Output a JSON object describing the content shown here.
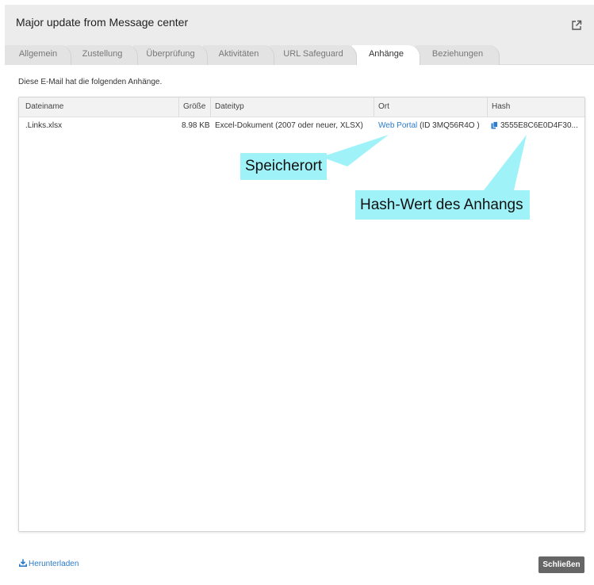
{
  "dialog": {
    "title": "Major update from Message center"
  },
  "tabs": [
    {
      "label": "Allgemein"
    },
    {
      "label": "Zustellung"
    },
    {
      "label": "Überprüfung"
    },
    {
      "label": "Aktivitäten"
    },
    {
      "label": "URL Safeguard"
    },
    {
      "label": "Anhänge"
    },
    {
      "label": "Beziehungen"
    }
  ],
  "intro": "Diese E-Mail hat die folgenden Anhänge.",
  "table": {
    "columns": [
      "Dateiname",
      "Größe",
      "Dateityp",
      "Ort",
      "Hash"
    ],
    "rows": [
      {
        "filename": ".Links.xlsx",
        "size": "8.98 KB",
        "filetype": "Excel-Dokument (2007 oder neuer, XLSX)",
        "location_link": "Web Portal",
        "location_id": "(ID 3MQ56R4O )",
        "hash": "3555E8C6E0D4F30..."
      }
    ]
  },
  "callouts": {
    "location": "Speicherort",
    "hash": "Hash-Wert des Anhangs"
  },
  "footer": {
    "download": "Herunterladen",
    "close": "Schließen"
  },
  "colors": {
    "link": "#2b7cc9",
    "callout": "#9ff3f8",
    "close_button": "#666666"
  }
}
